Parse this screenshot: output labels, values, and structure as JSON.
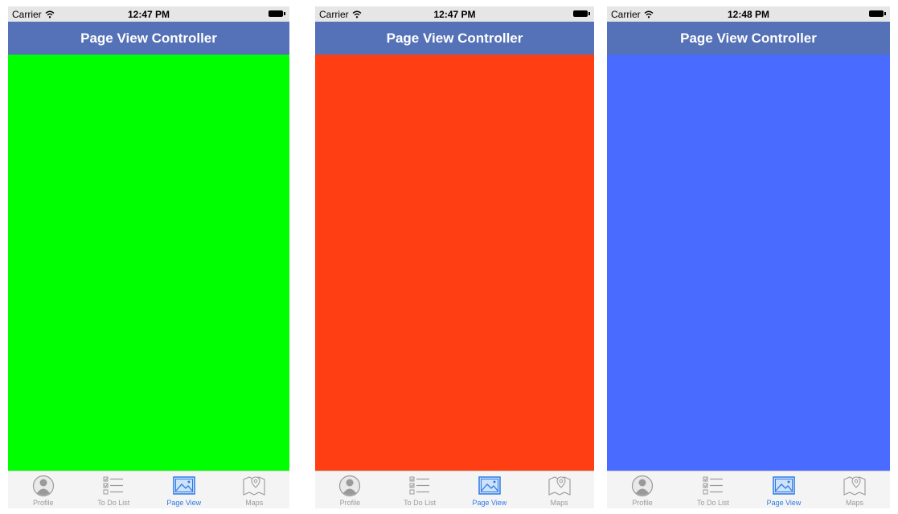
{
  "status_bar": {
    "carrier": "Carrier",
    "times": [
      "12:47 PM",
      "12:47 PM",
      "12:48 PM"
    ]
  },
  "nav": {
    "title": "Page View Controller"
  },
  "pages": [
    {
      "color": "#00ff00"
    },
    {
      "color": "#ff3e14"
    },
    {
      "color": "#4a6bff"
    }
  ],
  "tabs": [
    {
      "label": "Profile",
      "icon": "profile-icon"
    },
    {
      "label": "To Do List",
      "icon": "todo-list-icon"
    },
    {
      "label": "Page View",
      "icon": "page-view-icon"
    },
    {
      "label": "Maps",
      "icon": "maps-icon"
    }
  ],
  "active_tab": "Page View",
  "colors": {
    "nav_bar": "#5571b7",
    "tab_active": "#2f7ae5",
    "tab_inactive": "#9a9a9a"
  }
}
